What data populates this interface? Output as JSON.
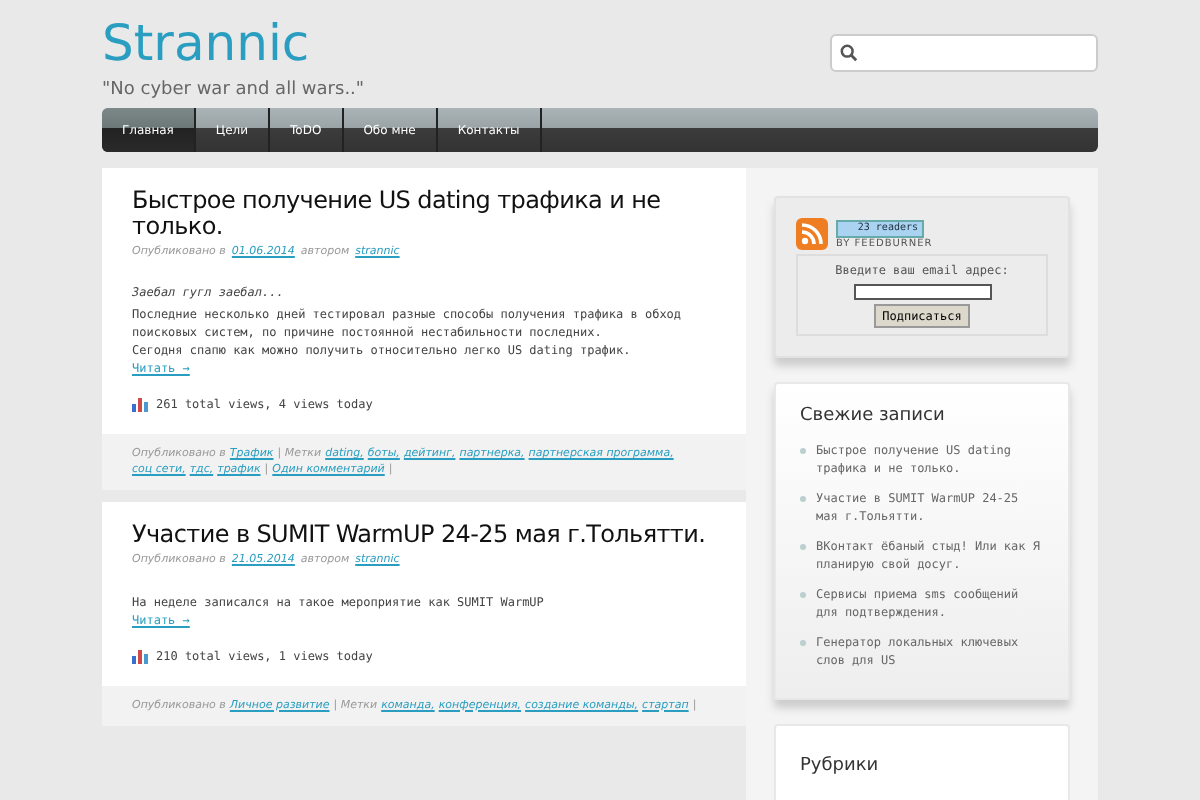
{
  "site": {
    "title": "Strannic",
    "tagline": "\"No cyber war and all wars..\""
  },
  "nav": [
    {
      "label": "Главная",
      "selected": true
    },
    {
      "label": "Цели",
      "selected": false
    },
    {
      "label": "ToDO",
      "selected": false
    },
    {
      "label": "Обо мне",
      "selected": false
    },
    {
      "label": "Контакты",
      "selected": false
    }
  ],
  "posts": [
    {
      "title": "Быстрое получение US dating трафика и не только.",
      "meta": [
        {
          "kind": "plain",
          "text": "Опубликовано в"
        },
        {
          "kind": "link",
          "text": "01.06.2014"
        },
        {
          "kind": "plain",
          "text": "автором"
        },
        {
          "kind": "link",
          "text": "strannic"
        }
      ],
      "lead": "Заебал гугл заебал...",
      "paragraphs": [
        "Последние несколько дней тестировал разные способы получения трафика в обход поисковых систем, по причине постоянной нестабильности последних.",
        "Сегодня спапю как можно получить относительно легко US dating трафик."
      ],
      "read_more": "Читать →",
      "stats": "261 total views, 4 views today",
      "footer": [
        {
          "kind": "plain",
          "text": "Опубликовано в"
        },
        {
          "kind": "link",
          "text": "Трафик"
        },
        {
          "kind": "plain",
          "text": "| Метки"
        },
        {
          "kind": "link",
          "text": "dating,"
        },
        {
          "kind": "link",
          "text": "боты,"
        },
        {
          "kind": "link",
          "text": "дейтинг,"
        },
        {
          "kind": "link",
          "text": "партнерка,"
        },
        {
          "kind": "link",
          "text": "партнерская программа,"
        },
        {
          "kind": "link",
          "text": "соц сети,"
        },
        {
          "kind": "link",
          "text": "тдс,"
        },
        {
          "kind": "link",
          "text": "трафик"
        },
        {
          "kind": "plain",
          "text": "|"
        },
        {
          "kind": "link",
          "text": "Один комментарий"
        },
        {
          "kind": "plain",
          "text": "|"
        }
      ]
    },
    {
      "title": "Участие в SUMIT WarmUP 24-25 мая г.Тольятти.",
      "meta": [
        {
          "kind": "plain",
          "text": "Опубликовано в"
        },
        {
          "kind": "link",
          "text": "21.05.2014"
        },
        {
          "kind": "plain",
          "text": "автором"
        },
        {
          "kind": "link",
          "text": "strannic"
        }
      ],
      "paragraphs": [
        "На неделе записался на такое мероприятие как SUMIT WarmUP"
      ],
      "read_more": "Читать →",
      "stats": "210 total views, 1 views today",
      "footer": [
        {
          "kind": "plain",
          "text": "Опубликовано в"
        },
        {
          "kind": "link",
          "text": "Личное развитие"
        },
        {
          "kind": "plain",
          "text": "| Метки"
        },
        {
          "kind": "link",
          "text": "команда,"
        },
        {
          "kind": "link",
          "text": "конференция,"
        },
        {
          "kind": "link",
          "text": "создание команды,"
        },
        {
          "kind": "link",
          "text": "стартап"
        },
        {
          "kind": "plain",
          "text": "|"
        }
      ]
    }
  ],
  "subscribe": {
    "readers": "23 readers",
    "by": "BY FEEDBURNER",
    "label": "Введите ваш email адрес:",
    "button": "Подписаться"
  },
  "recent": {
    "heading": "Свежие записи",
    "items": [
      "Быстрое получение US dating трафика и не только.",
      "Участие в SUMIT WarmUP 24-25 мая г.Тольятти.",
      "ВКонтакт ёбаный стыд! Или как Я планирую свой досуг.",
      "Сервисы приема sms сообщений для подтверждения.",
      "Генератор локальных ключевых слов для US"
    ]
  },
  "categories": {
    "heading": "Рубрики"
  }
}
